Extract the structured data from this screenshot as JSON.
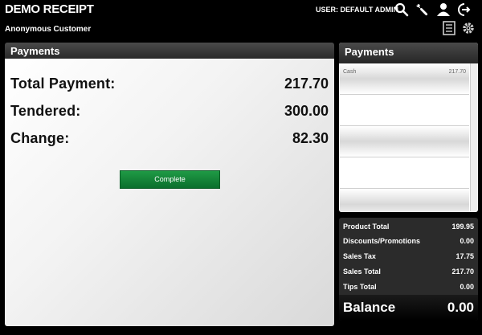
{
  "header": {
    "app_title": "DEMO RECEIPT",
    "user_label": "USER: DEFAULT ADMIN",
    "customer_name": "Anonymous Customer",
    "icons": [
      "search-icon",
      "wrench-icon",
      "user-icon",
      "logout-icon",
      "receipt-list-icon",
      "gear-icon"
    ]
  },
  "payment_summary": {
    "panel_title": "Payments",
    "rows": [
      {
        "label": "Total Payment:",
        "value": "217.70"
      },
      {
        "label": "Tendered:",
        "value": "300.00"
      },
      {
        "label": "Change:",
        "value": "82.30"
      }
    ],
    "complete_label": "Complete"
  },
  "payments_list": {
    "panel_title": "Payments",
    "items": [
      {
        "name": "Cash",
        "amount": "217.70"
      },
      {
        "name": "",
        "amount": ""
      },
      {
        "name": "",
        "amount": ""
      },
      {
        "name": "",
        "amount": ""
      },
      {
        "name": "",
        "amount": ""
      }
    ]
  },
  "totals": {
    "rows": [
      {
        "label": "Product Total",
        "value": "199.95"
      },
      {
        "label": "Discounts/Promotions",
        "value": "0.00"
      },
      {
        "label": "Sales Tax",
        "value": "17.75"
      },
      {
        "label": "Sales Total",
        "value": "217.70"
      },
      {
        "label": "Tips Total",
        "value": "0.00"
      }
    ],
    "balance_label": "Balance",
    "balance_value": "0.00"
  },
  "colors": {
    "accent_green": "#0f8a3a",
    "background": "#000000"
  }
}
